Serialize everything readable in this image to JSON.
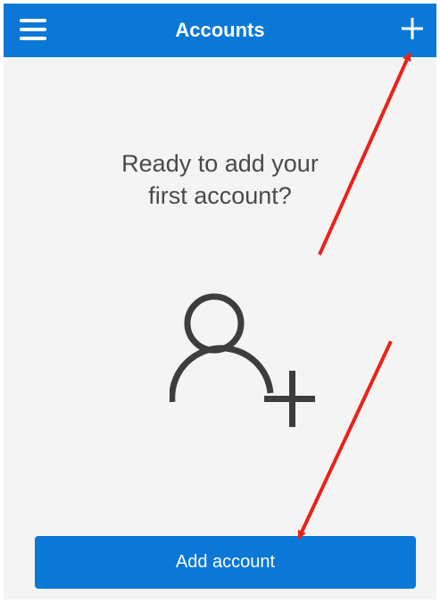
{
  "header": {
    "title": "Accounts",
    "menu_icon": "hamburger-menu-icon",
    "add_icon": "plus-icon"
  },
  "main": {
    "prompt_line1": "Ready to add your",
    "prompt_line2": "first account?",
    "illustration_icon": "add-person-icon",
    "add_account_label": "Add account"
  },
  "annotations": {
    "arrow_color": "#e8231c",
    "arrow_count": 2
  },
  "colors": {
    "accent": "#0b78d7",
    "background": "#f4f4f4",
    "text": "#4a4a4a",
    "icon": "#3d3d3d"
  }
}
